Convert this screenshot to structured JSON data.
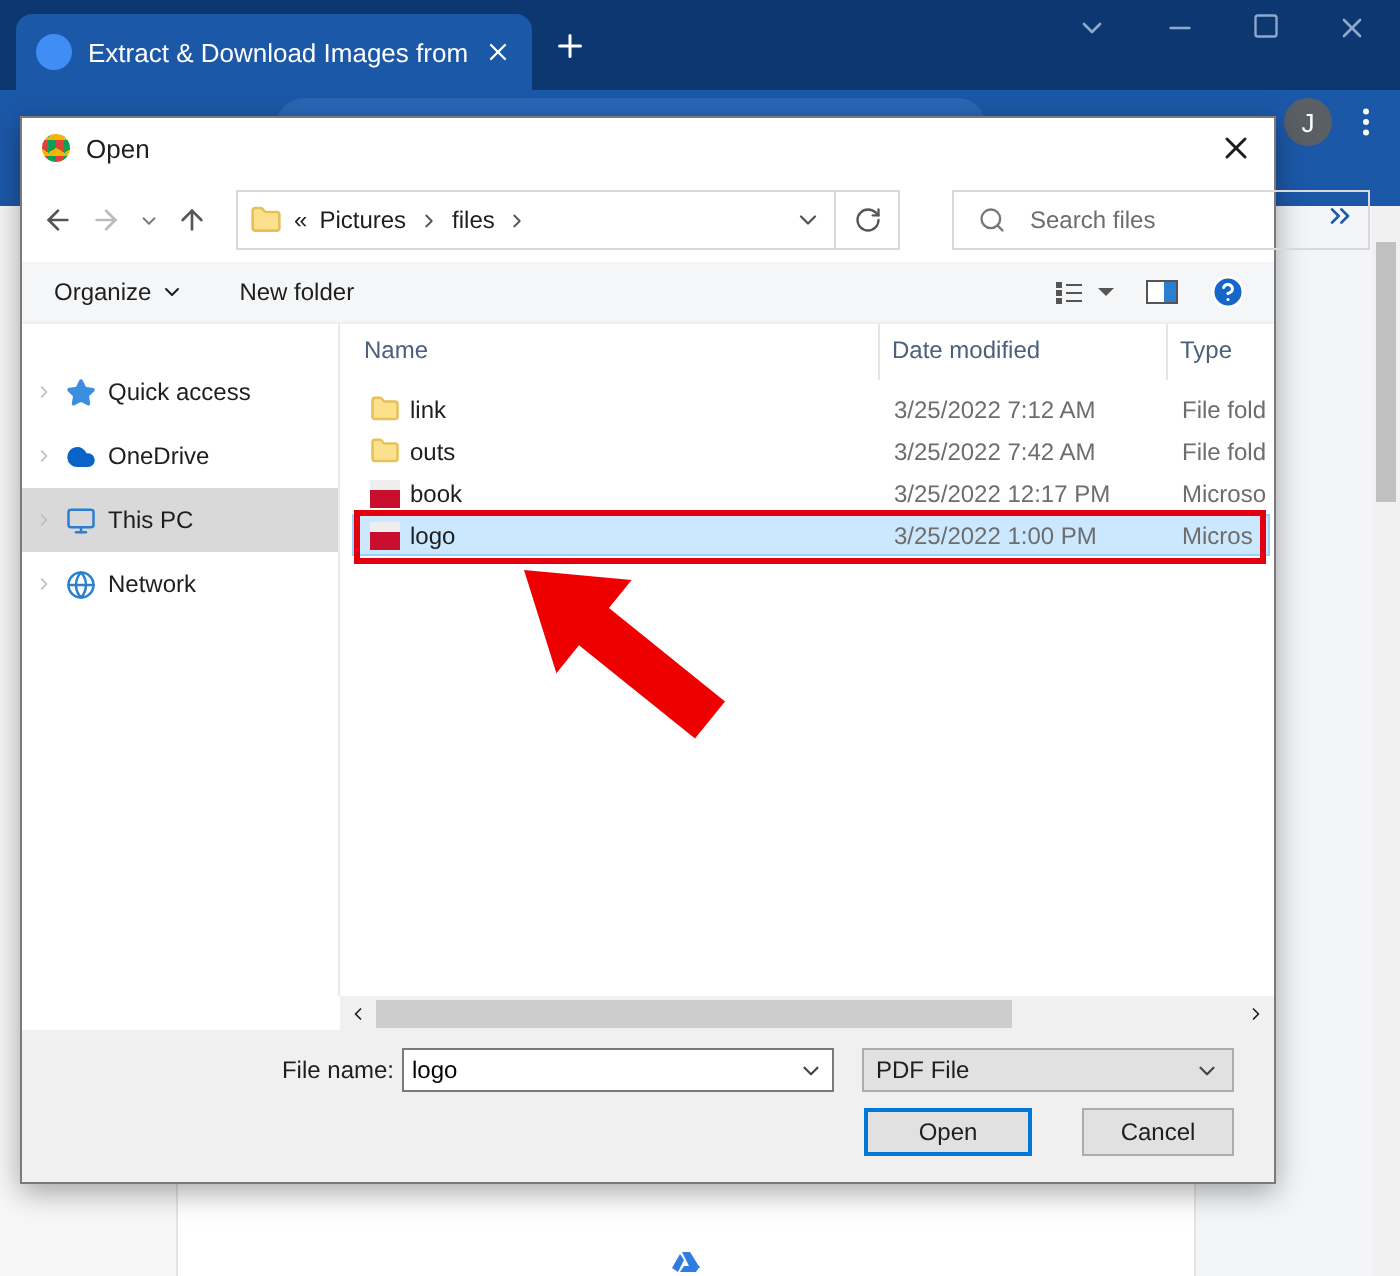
{
  "browser": {
    "tab_title": "Extract & Download Images from",
    "avatar": "J"
  },
  "dialog": {
    "title": "Open",
    "path": [
      "«",
      "Pictures",
      "files"
    ],
    "search": {
      "placeholder": "Search files"
    },
    "commands": [
      "Organize",
      "New folder"
    ],
    "nav": [
      {
        "label": "Quick access",
        "kind": "star",
        "selected": false
      },
      {
        "label": "OneDrive",
        "kind": "cloud",
        "selected": false
      },
      {
        "label": "This PC",
        "kind": "pc",
        "selected": true
      },
      {
        "label": "Network",
        "kind": "network",
        "selected": false
      }
    ],
    "columns": [
      "Name",
      "Date modified",
      "Type"
    ],
    "files": [
      {
        "name": "link",
        "date": "3/25/2022 7:12 AM",
        "type": "File fold",
        "kind": "folder",
        "selected": false
      },
      {
        "name": "outs",
        "date": "3/25/2022 7:42 AM",
        "type": "File fold",
        "kind": "folder",
        "selected": false
      },
      {
        "name": "book",
        "date": "3/25/2022 12:17 PM",
        "type": "Microso",
        "kind": "pdf",
        "selected": false
      },
      {
        "name": "logo",
        "date": "3/25/2022 1:00 PM",
        "type": "Micros",
        "kind": "pdf",
        "selected": true
      }
    ],
    "file_name_label": "File name:",
    "file_name": "logo",
    "filter": "PDF File",
    "buttons": [
      {
        "label": "Open",
        "default": true
      },
      {
        "label": "Cancel",
        "default": false
      }
    ]
  }
}
